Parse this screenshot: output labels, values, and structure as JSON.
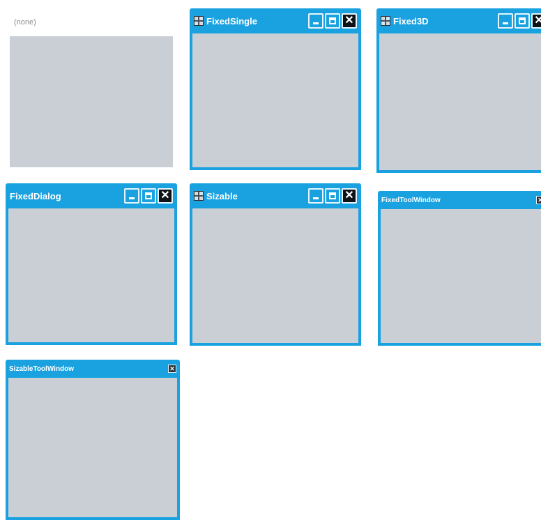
{
  "none_form": {
    "caption": "(none)"
  },
  "windows": [
    {
      "title": "FixedSingle",
      "buttons": [
        "minimize",
        "maximize",
        "close"
      ],
      "icon": "app-icon"
    },
    {
      "title": "Fixed3D",
      "buttons": [
        "minimize",
        "maximize",
        "close"
      ],
      "icon": "app-icon"
    },
    {
      "title": "FixedDialog",
      "buttons": [
        "minimize",
        "maximize",
        "close"
      ]
    },
    {
      "title": "Sizable",
      "buttons": [
        "minimize",
        "maximize",
        "close"
      ],
      "icon": "app-icon"
    },
    {
      "title": "FixedToolWindow",
      "buttons": [
        "close"
      ]
    },
    {
      "title": "SizableToolWindow",
      "buttons": [
        "close"
      ]
    }
  ],
  "glyphs": {
    "close": "✕",
    "tool_close": "✕"
  },
  "colors": {
    "titlebar": "#1aa2e0",
    "client": "#c9cfd4",
    "close_button": "#0f1216"
  }
}
